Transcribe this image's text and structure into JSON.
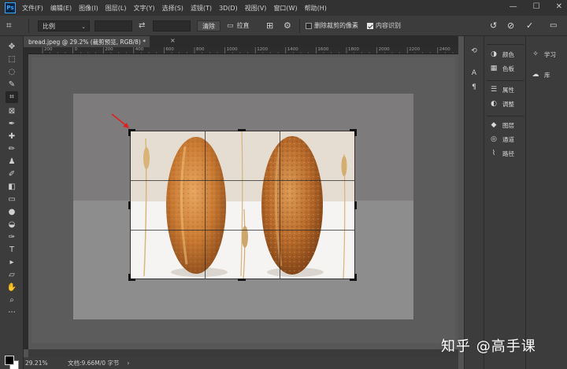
{
  "app": {
    "logo": "Ps",
    "menu": [
      "文件(F)",
      "编辑(E)",
      "图像(I)",
      "图层(L)",
      "文字(Y)",
      "选择(S)",
      "滤镜(T)",
      "3D(D)",
      "视图(V)",
      "窗口(W)",
      "帮助(H)"
    ],
    "window_controls": [
      "minimize-icon",
      "maximize-icon",
      "close-icon"
    ],
    "window_control_glyphs": [
      "—",
      "☐",
      "✕"
    ]
  },
  "options_bar": {
    "ratio_select": "比例",
    "clear_button": "清除",
    "straighten_label": "拉直",
    "delete_cropped_label": "删除裁剪的像素",
    "delete_cropped_checked": false,
    "content_aware_label": "内容识别",
    "content_aware_checked": true
  },
  "document_tab": {
    "title": "bread.jpeg @ 29.2% (裁剪预览, RGB/8) *",
    "close": "×"
  },
  "rulers": {
    "top_labels": [
      "200",
      "0",
      "200",
      "400",
      "600",
      "800",
      "1000",
      "1200",
      "1400",
      "1600",
      "1800",
      "2000",
      "2200",
      "2400",
      "2600"
    ]
  },
  "tools": [
    {
      "name": "move-tool-icon",
      "glyph": "✥"
    },
    {
      "name": "marquee-tool-icon",
      "glyph": "⬚"
    },
    {
      "name": "lasso-tool-icon",
      "glyph": "◌"
    },
    {
      "name": "quick-select-tool-icon",
      "glyph": "✎"
    },
    {
      "name": "crop-tool-icon",
      "glyph": "⌗",
      "active": true
    },
    {
      "name": "frame-tool-icon",
      "glyph": "⊠"
    },
    {
      "name": "eyedropper-tool-icon",
      "glyph": "✒"
    },
    {
      "name": "healing-brush-tool-icon",
      "glyph": "✚"
    },
    {
      "name": "brush-tool-icon",
      "glyph": "✏"
    },
    {
      "name": "stamp-tool-icon",
      "glyph": "♟"
    },
    {
      "name": "history-brush-tool-icon",
      "glyph": "✐"
    },
    {
      "name": "eraser-tool-icon",
      "glyph": "◧"
    },
    {
      "name": "gradient-tool-icon",
      "glyph": "▭"
    },
    {
      "name": "blur-tool-icon",
      "glyph": "●"
    },
    {
      "name": "dodge-tool-icon",
      "glyph": "◒"
    },
    {
      "name": "pen-tool-icon",
      "glyph": "✑"
    },
    {
      "name": "type-tool-icon",
      "glyph": "T"
    },
    {
      "name": "path-select-tool-icon",
      "glyph": "▸"
    },
    {
      "name": "shape-tool-icon",
      "glyph": "▱"
    },
    {
      "name": "hand-tool-icon",
      "glyph": "✋"
    },
    {
      "name": "zoom-tool-icon",
      "glyph": "⌕"
    },
    {
      "name": "more-tools-icon",
      "glyph": "···"
    }
  ],
  "status_bar": {
    "zoom": "29.21%",
    "doc_info": "文档:9.66M/0 字节",
    "arrow": "›"
  },
  "dock": [
    {
      "name": "history-panel-icon",
      "glyph": "⟲"
    },
    {
      "name": "character-panel-icon",
      "glyph": "A"
    },
    {
      "name": "paragraph-panel-icon",
      "glyph": "¶"
    }
  ],
  "panels": {
    "group1": [
      {
        "label": "颜色",
        "icon": "color-panel-icon",
        "glyph": "◑"
      },
      {
        "label": "色板",
        "icon": "swatches-panel-icon",
        "glyph": "▦"
      }
    ],
    "group2": [
      {
        "label": "属性",
        "icon": "properties-panel-icon",
        "glyph": "☰"
      },
      {
        "label": "调整",
        "icon": "adjustments-panel-icon",
        "glyph": "◐"
      }
    ],
    "group3": [
      {
        "label": "图层",
        "icon": "layers-panel-icon",
        "glyph": "◆"
      },
      {
        "label": "通道",
        "icon": "channels-panel-icon",
        "glyph": "◎"
      },
      {
        "label": "路径",
        "icon": "paths-panel-icon",
        "glyph": "⌇"
      }
    ],
    "learn": [
      {
        "label": "学习",
        "icon": "learn-panel-icon",
        "glyph": "✧"
      },
      {
        "label": "库",
        "icon": "libraries-panel-icon",
        "glyph": "☁"
      }
    ]
  },
  "watermark": "知乎 @高手课",
  "colors": {
    "accent": "#31a8ff",
    "annotation_arrow": "#e02020"
  }
}
